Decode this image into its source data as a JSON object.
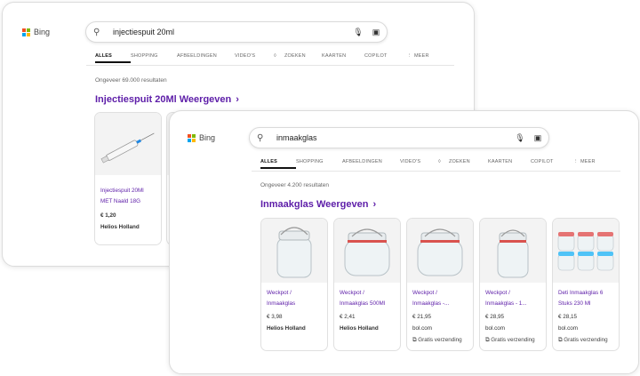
{
  "back": {
    "logo": "Bing",
    "query": "injectiespuit 20ml",
    "tabs": [
      "ALLES",
      "SHOPPING",
      "AFBEELDINGEN",
      "VIDEO'S",
      "ZOEKEN",
      "KAARTEN",
      "COPILOT",
      "MEER"
    ],
    "result_count": "Ongeveer 69.000 resultaten",
    "heading": "Injectiespuit 20Ml Weergeven",
    "product": {
      "name_line1": "Injectiespuit 20Ml",
      "name_line2": "MET Naald 18G",
      "price": "€ 1,20",
      "seller": "Helios Holland"
    }
  },
  "front": {
    "logo": "Bing",
    "query": "inmaakglas",
    "tabs": [
      "ALLES",
      "SHOPPING",
      "AFBEELDINGEN",
      "VIDEO'S",
      "ZOEKEN",
      "KAARTEN",
      "COPILOT",
      "MEER"
    ],
    "result_count": "Ongeveer 4.200 resultaten",
    "heading": "Inmaakglas Weergeven",
    "products": [
      {
        "name_line1": "Weckpot /",
        "name_line2": "Inmaakglas",
        "price": "€ 3,98",
        "seller": "Helios Holland",
        "shipping": ""
      },
      {
        "name_line1": "Weckpot /",
        "name_line2": "Inmaakglas 500Ml",
        "price": "€ 2,41",
        "seller": "Helios Holland",
        "shipping": ""
      },
      {
        "name_line1": "Weckpot /",
        "name_line2": "Inmaakglas -...",
        "price": "€ 21,95",
        "seller": "bol.com",
        "shipping": "Gratis verzending"
      },
      {
        "name_line1": "Weckpot /",
        "name_line2": "Inmaakglas - 1...",
        "price": "€ 28,95",
        "seller": "bol.com",
        "shipping": "Gratis verzending"
      },
      {
        "name_line1": "Deti Inmaakglas 6",
        "name_line2": "Stuks 230 Ml",
        "price": "€ 28,15",
        "seller": "bol.com",
        "shipping": "Gratis verzending"
      }
    ]
  },
  "colors": {
    "heading": "#5d1da8",
    "accent_tab": "#111111"
  },
  "icons": {
    "search": "search-icon",
    "mic": "microphone-icon",
    "visual": "visual-search-icon",
    "copilot": "copilot-icon",
    "more": "more-icon",
    "shipping": "shipping-icon"
  }
}
